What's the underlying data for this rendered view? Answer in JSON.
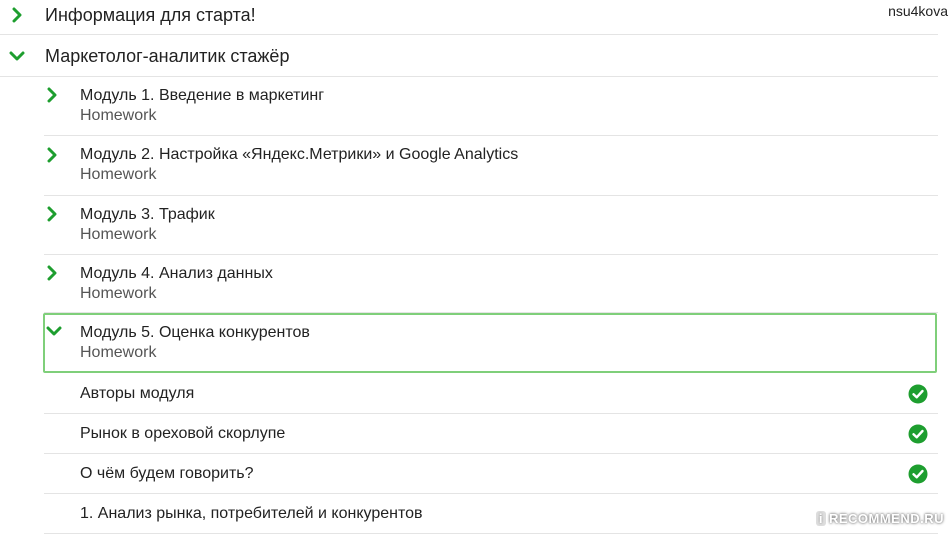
{
  "header": {
    "user": "nsu4kova"
  },
  "sections": [
    {
      "title": "Информация для старта!",
      "state": "collapsed"
    },
    {
      "title": "Маркетолог-аналитик стажёр",
      "state": "expanded"
    }
  ],
  "modules": [
    {
      "title": "Модуль 1. Введение в маркетинг",
      "subtitle": "Homework",
      "state": "collapsed"
    },
    {
      "title": "Модуль 2. Настройка «Яндекс.Метрики» и Google Analytics",
      "subtitle": "Homework",
      "state": "collapsed"
    },
    {
      "title": "Модуль 3. Трафик",
      "subtitle": "Homework",
      "state": "collapsed"
    },
    {
      "title": "Модуль 4. Анализ данных",
      "subtitle": "Homework",
      "state": "collapsed"
    },
    {
      "title": "Модуль 5. Оценка конкурентов",
      "subtitle": "Homework",
      "state": "expanded"
    }
  ],
  "lessons": [
    {
      "title": "Авторы модуля",
      "completed": true
    },
    {
      "title": "Рынок в ореховой скорлупе",
      "completed": true
    },
    {
      "title": "О чём будем говорить?",
      "completed": true
    },
    {
      "title": "1. Анализ рынка, потребителей и конкурентов",
      "completed": false
    }
  ],
  "watermark": {
    "badge": "i",
    "text": "RECOMMEND.RU"
  },
  "colors": {
    "accent": "#1e9e2f",
    "active_border": "#7fcf7a",
    "divider": "#e4e4e4"
  },
  "icons": {
    "collapsed": "chevron-right-icon",
    "expanded": "chevron-down-icon",
    "completed": "check-circle-icon"
  }
}
